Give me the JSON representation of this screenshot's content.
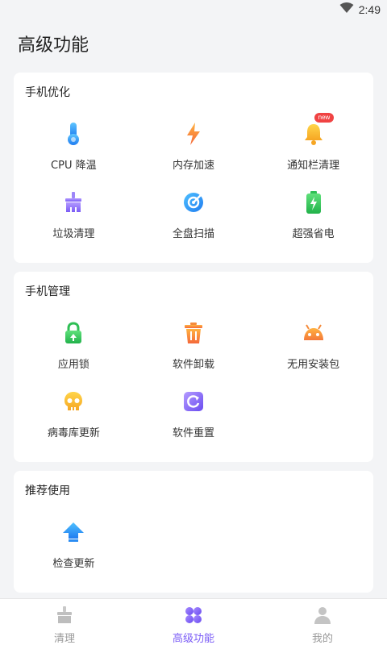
{
  "status": {
    "time": "2:49"
  },
  "page_title": "高级功能",
  "sections": [
    {
      "title": "手机优化",
      "items": [
        {
          "label": "CPU 降温",
          "icon": "thermometer-icon"
        },
        {
          "label": "内存加速",
          "icon": "lightning-icon"
        },
        {
          "label": "通知栏清理",
          "icon": "bell-icon",
          "badge": "new"
        },
        {
          "label": "垃圾清理",
          "icon": "broom-icon"
        },
        {
          "label": "全盘扫描",
          "icon": "disk-scan-icon"
        },
        {
          "label": "超强省电",
          "icon": "battery-icon"
        }
      ]
    },
    {
      "title": "手机管理",
      "items": [
        {
          "label": "应用锁",
          "icon": "lock-icon"
        },
        {
          "label": "软件卸载",
          "icon": "trash-icon"
        },
        {
          "label": "无用安装包",
          "icon": "android-icon"
        },
        {
          "label": "病毒库更新",
          "icon": "skull-icon"
        },
        {
          "label": "软件重置",
          "icon": "reset-icon"
        }
      ]
    },
    {
      "title": "推荐使用",
      "items": [
        {
          "label": "检查更新",
          "icon": "upgrade-arrow-icon"
        }
      ]
    }
  ],
  "tabbar": {
    "tabs": [
      {
        "label": "清理",
        "icon": "broom-tab-icon",
        "active": false
      },
      {
        "label": "高级功能",
        "icon": "grid-flower-tab-icon",
        "active": true
      },
      {
        "label": "我的",
        "icon": "user-tab-icon",
        "active": false
      }
    ]
  },
  "colors": {
    "accent": "#7b5cf6",
    "badge": "#f04343",
    "background": "#f3f4f6"
  }
}
